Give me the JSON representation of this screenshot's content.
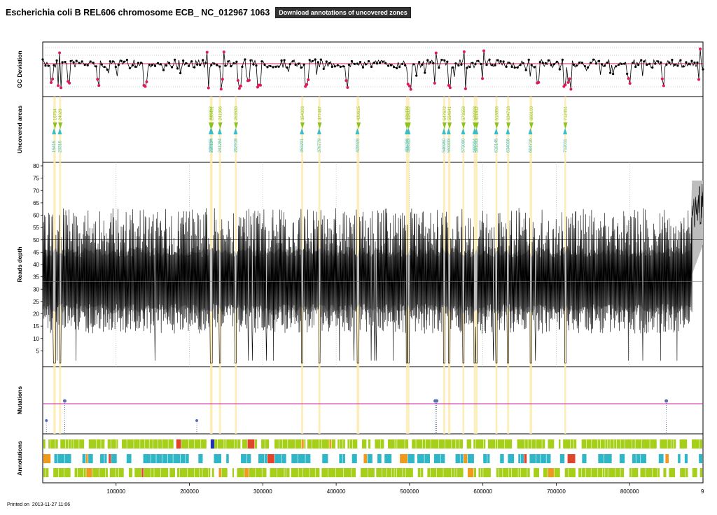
{
  "header": {
    "title": "Escherichia coli B REL606 chromosome ECB_ NC_012967 1063",
    "download_label": "Download annotations of uncovered zones"
  },
  "footer": {
    "printed_label": "Printed on",
    "timestamp": "2013-11-27 11:06"
  },
  "colors": {
    "gc_line": "#000000",
    "gc_outlier": "#e2185b",
    "gc_baseline": "#e2185b",
    "zone_start": "#8cc21c",
    "zone_end": "#3bbdc2",
    "zone_band": "#fde9a8",
    "depth_fill": "#bdbdbd",
    "depth_line": "#000000",
    "mutation_line": "#d21fa7",
    "mutation_point": "#5b6fb8",
    "annotation_green": "#a5cf18",
    "annotation_cyan": "#2fb7c8",
    "annotation_red": "#e0452b",
    "annotation_orange": "#f09a1d",
    "annotation_blue": "#1f2fbf"
  },
  "chart_data": {
    "type": "line",
    "x_axis": {
      "range": [
        0,
        900000
      ],
      "ticks": [
        100000,
        200000,
        300000,
        400000,
        500000,
        600000,
        700000,
        800000
      ],
      "tick_labels": [
        "100000",
        "200000",
        "300000",
        "400000",
        "500000",
        "600000",
        "700000",
        "800000"
      ],
      "truncated_last_label": "9"
    },
    "panels": {
      "gc": {
        "ylabel": "GC Deviation",
        "baseline": 0,
        "outlier_positions": [
          12000,
          23000,
          35000,
          75000,
          140000,
          225000,
          245000,
          268000,
          280000,
          295000,
          360000,
          415000,
          500000,
          535000,
          555000,
          575000,
          600000,
          675000,
          712000,
          718000,
          800000,
          845000,
          895000
        ]
      },
      "uncovered": {
        "ylabel": "Uncovered areas",
        "zones": [
          {
            "start": "15416",
            "end": "16764"
          },
          {
            "start": "23316",
            "end": "24029"
          },
          {
            "start": "228955",
            "end": "229052"
          },
          {
            "start": "230124",
            "end": "230451"
          },
          {
            "start": "241284",
            "end": "241996"
          },
          {
            "start": "262918",
            "end": "263530"
          },
          {
            "start": "353291",
            "end": "354003"
          },
          {
            "start": "376779",
            "end": "377487"
          },
          {
            "start": "428928",
            "end": "430615"
          },
          {
            "start": "496258",
            "end": "496338"
          },
          {
            "start": "498563",
            "end": "498922"
          },
          {
            "start": "546960",
            "end": "547672"
          },
          {
            "start": "553333",
            "end": "554641"
          },
          {
            "start": "573080",
            "end": "573558"
          },
          {
            "start": "588564",
            "end": "588998"
          },
          {
            "start": "591043",
            "end": "591612"
          },
          {
            "start": "618145",
            "end": "618856"
          },
          {
            "start": "634006",
            "end": "634718"
          },
          {
            "start": "664716",
            "end": "666100"
          },
          {
            "start": "712011",
            "end": "712451"
          }
        ]
      },
      "depth": {
        "ylabel": "Reads depth",
        "ylim": [
          0,
          80
        ],
        "yticks": [
          5,
          10,
          15,
          20,
          25,
          30,
          35,
          40,
          45,
          50,
          55,
          60,
          65,
          70,
          75,
          80
        ],
        "typical_mean": 33,
        "typical_band": [
          22,
          45
        ],
        "high_coverage_end": {
          "from": 885000,
          "to": 900000,
          "level": [
            55,
            80
          ]
        }
      },
      "mutations": {
        "ylabel": "Mutations",
        "points": [
          {
            "x": 5000,
            "level": "low"
          },
          {
            "x": 30000,
            "level": "high"
          },
          {
            "x": 210000,
            "level": "low"
          },
          {
            "x": 535000,
            "level": "high"
          },
          {
            "x": 537000,
            "level": "high"
          },
          {
            "x": 850000,
            "level": "high"
          }
        ]
      },
      "annotations": {
        "ylabel": "Annotations",
        "rows": 3
      }
    }
  }
}
